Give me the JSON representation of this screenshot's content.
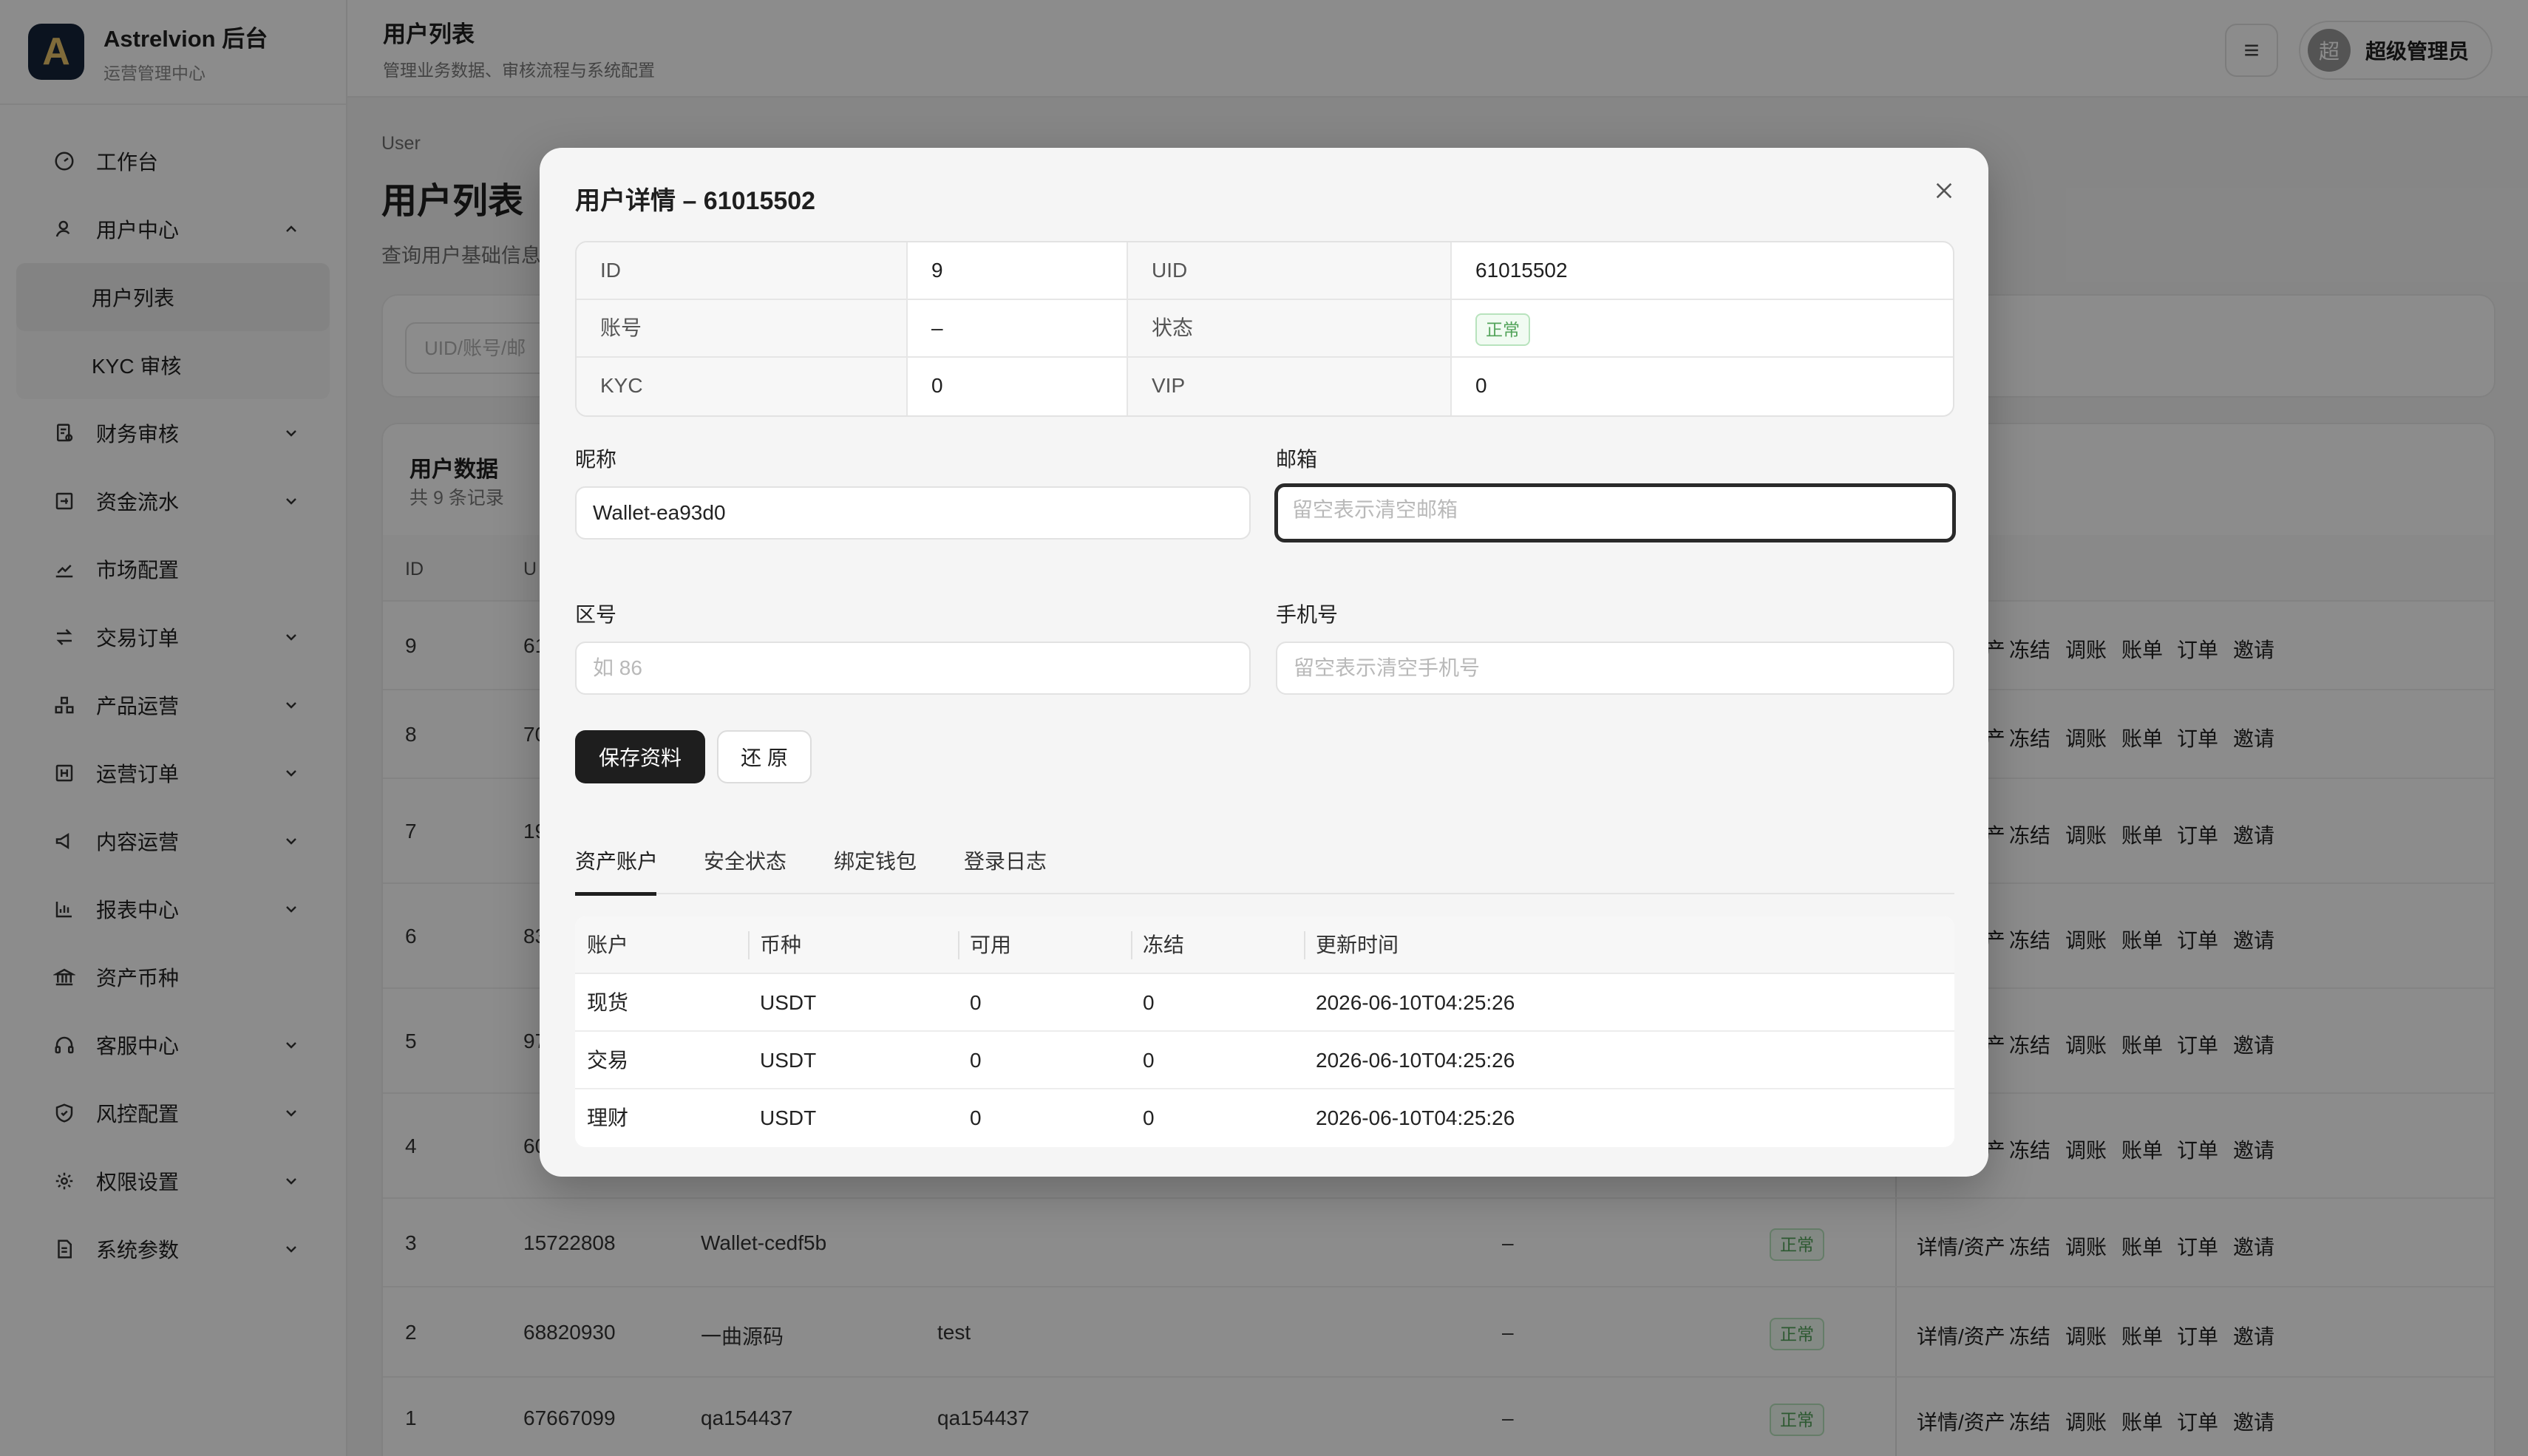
{
  "brand": {
    "logo_letter": "A",
    "title": "Astrelvion 后台",
    "subtitle": "运营管理中心"
  },
  "header": {
    "title": "用户列表",
    "subtitle": "管理业务数据、审核流程与系统配置",
    "avatar_text": "超",
    "user_name": "超级管理员"
  },
  "sidebar": {
    "items": [
      {
        "label": "工作台",
        "icon": "dashboard-icon"
      },
      {
        "label": "用户中心",
        "icon": "user-icon",
        "expanded": true
      },
      {
        "label": "财务审核",
        "icon": "audit-icon"
      },
      {
        "label": "资金流水",
        "icon": "ledger-icon"
      },
      {
        "label": "市场配置",
        "icon": "chart-line-icon"
      },
      {
        "label": "交易订单",
        "icon": "exchange-icon"
      },
      {
        "label": "产品运营",
        "icon": "product-icon"
      },
      {
        "label": "运营订单",
        "icon": "order-icon"
      },
      {
        "label": "内容运营",
        "icon": "megaphone-icon"
      },
      {
        "label": "报表中心",
        "icon": "bar-chart-icon"
      },
      {
        "label": "资产币种",
        "icon": "bank-icon"
      },
      {
        "label": "客服中心",
        "icon": "headset-icon"
      },
      {
        "label": "风控配置",
        "icon": "shield-icon"
      },
      {
        "label": "权限设置",
        "icon": "gear-icon"
      },
      {
        "label": "系统参数",
        "icon": "document-icon"
      }
    ],
    "sub_items": [
      {
        "label": "用户列表",
        "active": true
      },
      {
        "label": "KYC 审核",
        "active": false
      }
    ]
  },
  "page": {
    "breadcrumb": "User",
    "title": "用户列表",
    "desc": "查询用户基础信息",
    "search_placeholder": "UID/账号/邮"
  },
  "user_table": {
    "title": "用户数据",
    "subtitle": "共 9 条记录",
    "headers": {
      "id": "ID",
      "uid": "U"
    },
    "ops": [
      "详情/资产",
      "冻结",
      "调账",
      "账单",
      "订单",
      "邀请"
    ],
    "rows": [
      {
        "id": "9",
        "uid": "61",
        "nick": "",
        "account": "",
        "email": "",
        "status": ""
      },
      {
        "id": "8",
        "uid": "70",
        "nick": "",
        "account": "",
        "email": "",
        "status": ""
      },
      {
        "id": "7",
        "uid": "19",
        "nick": "",
        "account": "",
        "email": "",
        "status": ""
      },
      {
        "id": "6",
        "uid": "83",
        "nick": "",
        "account": "",
        "email": "",
        "status": ""
      },
      {
        "id": "5",
        "uid": "97",
        "nick": "",
        "account": "",
        "email": "",
        "status": ""
      },
      {
        "id": "4",
        "uid": "60",
        "nick": "",
        "account": "",
        "email": "",
        "status": ""
      },
      {
        "id": "3",
        "uid": "15722808",
        "nick": "Wallet-cedf5b",
        "account": "",
        "email": "–",
        "status": "正常"
      },
      {
        "id": "2",
        "uid": "68820930",
        "nick": "一曲源码",
        "account": "test",
        "email": "–",
        "status": "正常"
      },
      {
        "id": "1",
        "uid": "67667099",
        "nick": "qa154437",
        "account": "qa154437",
        "email": "–",
        "status": "正常"
      }
    ]
  },
  "modal": {
    "title": "用户详情 – 61015502",
    "info": {
      "id_label": "ID",
      "id_value": "9",
      "uid_label": "UID",
      "uid_value": "61015502",
      "account_label": "账号",
      "account_value": "–",
      "status_label": "状态",
      "status_value": "正常",
      "kyc_label": "KYC",
      "kyc_value": "0",
      "vip_label": "VIP",
      "vip_value": "0"
    },
    "form": {
      "nickname_label": "昵称",
      "nickname_value": "Wallet-ea93d0",
      "email_label": "邮箱",
      "email_placeholder": "留空表示清空邮箱",
      "area_label": "区号",
      "area_placeholder": "如 86",
      "phone_label": "手机号",
      "phone_placeholder": "留空表示清空手机号",
      "save_label": "保存资料",
      "reset_label": "还 原"
    },
    "tabs": [
      "资产账户",
      "安全状态",
      "绑定钱包",
      "登录日志"
    ],
    "asset_table": {
      "headers": [
        "账户",
        "币种",
        "可用",
        "冻结",
        "更新时间"
      ],
      "rows": [
        [
          "现货",
          "USDT",
          "0",
          "0",
          "2026-06-10T04:25:26"
        ],
        [
          "交易",
          "USDT",
          "0",
          "0",
          "2026-06-10T04:25:26"
        ],
        [
          "理财",
          "USDT",
          "0",
          "0",
          "2026-06-10T04:25:26"
        ]
      ]
    }
  }
}
